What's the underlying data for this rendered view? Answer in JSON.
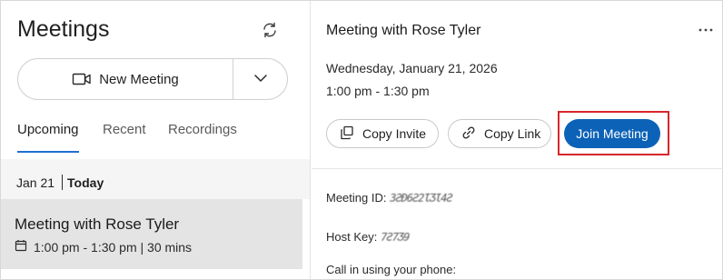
{
  "left": {
    "title": "Meetings",
    "refresh_icon": "refresh-icon",
    "new_meeting": {
      "label": "New Meeting",
      "icon": "video-camera-icon",
      "caret_icon": "chevron-down-icon"
    },
    "tabs": [
      {
        "label": "Upcoming",
        "active": true
      },
      {
        "label": "Recent",
        "active": false
      },
      {
        "label": "Recordings",
        "active": false
      }
    ],
    "date_group": {
      "date": "Jan 21",
      "day": "Today"
    },
    "meeting": {
      "title": "Meeting with Rose Tyler",
      "time": "1:00 pm - 1:30 pm | 30 mins",
      "icon": "calendar-icon"
    }
  },
  "right": {
    "title": "Meeting with Rose Tyler",
    "more_icon": "more-options-icon",
    "date": "Wednesday, January 21, 2026",
    "time": "1:00 pm - 1:30 pm",
    "buttons": {
      "copy_invite": "Copy Invite",
      "copy_link": "Copy Link",
      "join": "Join Meeting"
    },
    "meeting_id_label": "Meeting ID: ",
    "meeting_id_value": "3ƧƉ6Ƨ2ƖƷƖ4Ƨ",
    "host_key_label": "Host Key: ",
    "host_key_value": "7Ƨ7Ʒ9",
    "call_in": "Call in using your phone:"
  },
  "colors": {
    "accent": "#0c62b7",
    "tab_underline": "#1f6fd0",
    "highlight_box": "#d9262b",
    "selected_row": "#e4e4e4",
    "date_row": "#f5f5f5"
  }
}
